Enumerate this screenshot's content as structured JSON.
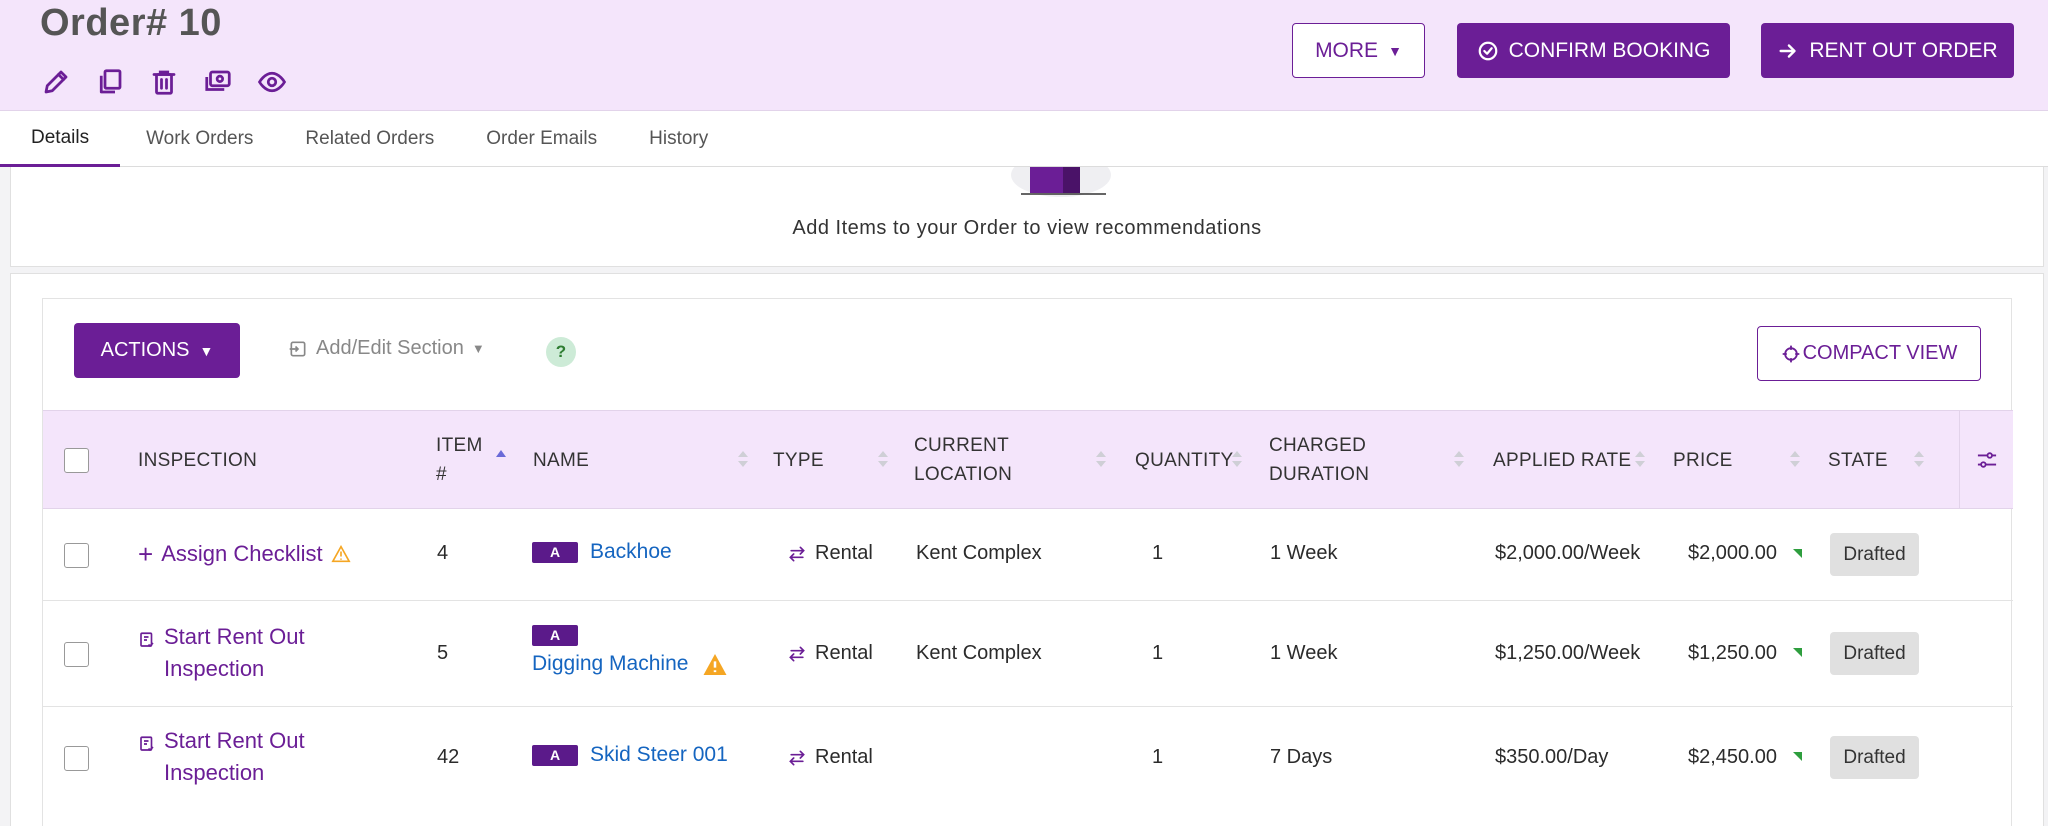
{
  "header": {
    "title": "Order# 10",
    "more_label": "MORE",
    "confirm_label": "CONFIRM BOOKING",
    "rentout_label": "RENT OUT ORDER",
    "icons": [
      "edit-icon",
      "duplicate-icon",
      "delete-icon",
      "payment-icon",
      "view-icon"
    ]
  },
  "tabs": [
    "Details",
    "Work Orders",
    "Related Orders",
    "Order Emails",
    "History"
  ],
  "recommendations": {
    "message": "Add Items to your Order to view recommendations"
  },
  "toolbar": {
    "actions_label": "ACTIONS",
    "add_section_label": "Add/Edit Section",
    "help_label": "?",
    "compact_label": "COMPACT VIEW"
  },
  "table": {
    "headers": {
      "inspection": "INSPECTION",
      "item_line1": "ITEM",
      "item_line2": "#",
      "name": "NAME",
      "type": "TYPE",
      "location_line1": "CURRENT",
      "location_line2": "LOCATION",
      "quantity": "QUANTITY",
      "duration_line1": "CHARGED",
      "duration_line2": "DURATION",
      "rate": "APPLIED RATE",
      "price": "PRICE",
      "state": "STATE"
    },
    "rows": [
      {
        "inspection_line1": "Assign Checklist",
        "inspection_line2": "",
        "item": "4",
        "category": "A",
        "name": "Backhoe",
        "type": "Rental",
        "location": "Kent Complex",
        "quantity": "1",
        "duration": "1 Week",
        "rate": "$2,000.00/Week",
        "price": "$2,000.00",
        "state": "Drafted"
      },
      {
        "inspection_line1": "Start Rent Out",
        "inspection_line2": "Inspection",
        "item": "5",
        "category": "A",
        "name": "Digging Machine",
        "type": "Rental",
        "location": "Kent Complex",
        "quantity": "1",
        "duration": "1 Week",
        "rate": "$1,250.00/Week",
        "price": "$1,250.00",
        "state": "Drafted"
      },
      {
        "inspection_line1": "Start Rent Out",
        "inspection_line2": "Inspection",
        "item": "42",
        "category": "A",
        "name": "Skid Steer 001",
        "type": "Rental",
        "location": "",
        "quantity": "1",
        "duration": "7 Days",
        "rate": "$350.00/Day",
        "price": "$2,450.00",
        "state": "Drafted"
      }
    ]
  },
  "colors": {
    "brand": "#6b1e96",
    "header_bg": "#f4e5fb",
    "link": "#1565c0",
    "warning": "#f5a623"
  }
}
